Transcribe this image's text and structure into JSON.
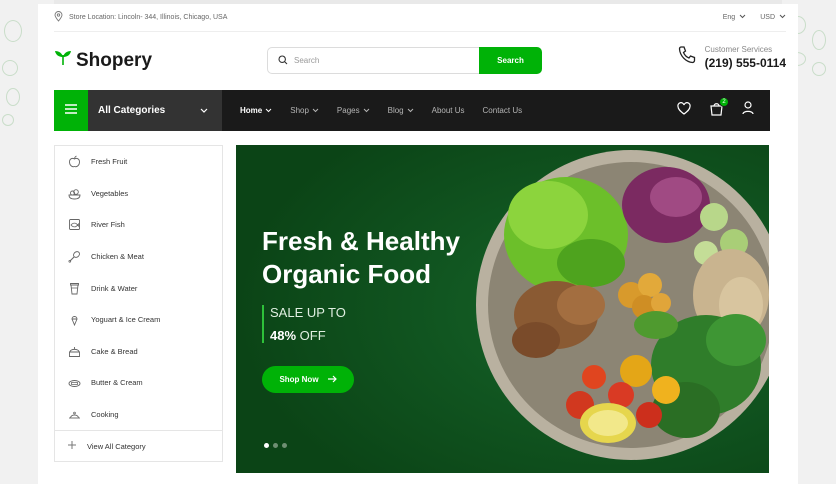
{
  "topbar": {
    "location": "Store Location: Lincoln- 344, Illinois, Chicago, USA",
    "language": "Eng",
    "currency": "USD"
  },
  "header": {
    "brand": "Shopery",
    "search_placeholder": "Search",
    "search_button": "Search",
    "service_label": "Customer Services",
    "service_phone": "(219) 555-0114"
  },
  "nav": {
    "all_categories": "All Categories",
    "links": [
      "Home",
      "Shop",
      "Pages",
      "Blog",
      "About Us",
      "Contact Us"
    ],
    "cart_count": "2"
  },
  "categories": {
    "items": [
      {
        "label": "Fresh Fruit",
        "icon": "apple-icon"
      },
      {
        "label": "Vegetables",
        "icon": "vegetables-icon"
      },
      {
        "label": "River Fish",
        "icon": "fish-icon"
      },
      {
        "label": "Chicken & Meat",
        "icon": "drumstick-icon"
      },
      {
        "label": "Drink & Water",
        "icon": "cup-icon"
      },
      {
        "label": "Yoguart & Ice Cream",
        "icon": "ice-cream-icon"
      },
      {
        "label": "Cake & Bread",
        "icon": "cake-icon"
      },
      {
        "label": "Butter & Cream",
        "icon": "butter-icon"
      },
      {
        "label": "Cooking",
        "icon": "cooking-pot-icon"
      }
    ],
    "view_all": "View All Category"
  },
  "hero": {
    "title_line1": "Fresh & Healthy",
    "title_line2": "Organic Food",
    "sale_line": "SALE UP TO",
    "discount": "48%",
    "discount_suffix": "OFF",
    "button": "Shop Now"
  },
  "colors": {
    "accent": "#00b207",
    "nav_bg": "#1a1a1a",
    "hero_bg": "#0e4f19"
  }
}
